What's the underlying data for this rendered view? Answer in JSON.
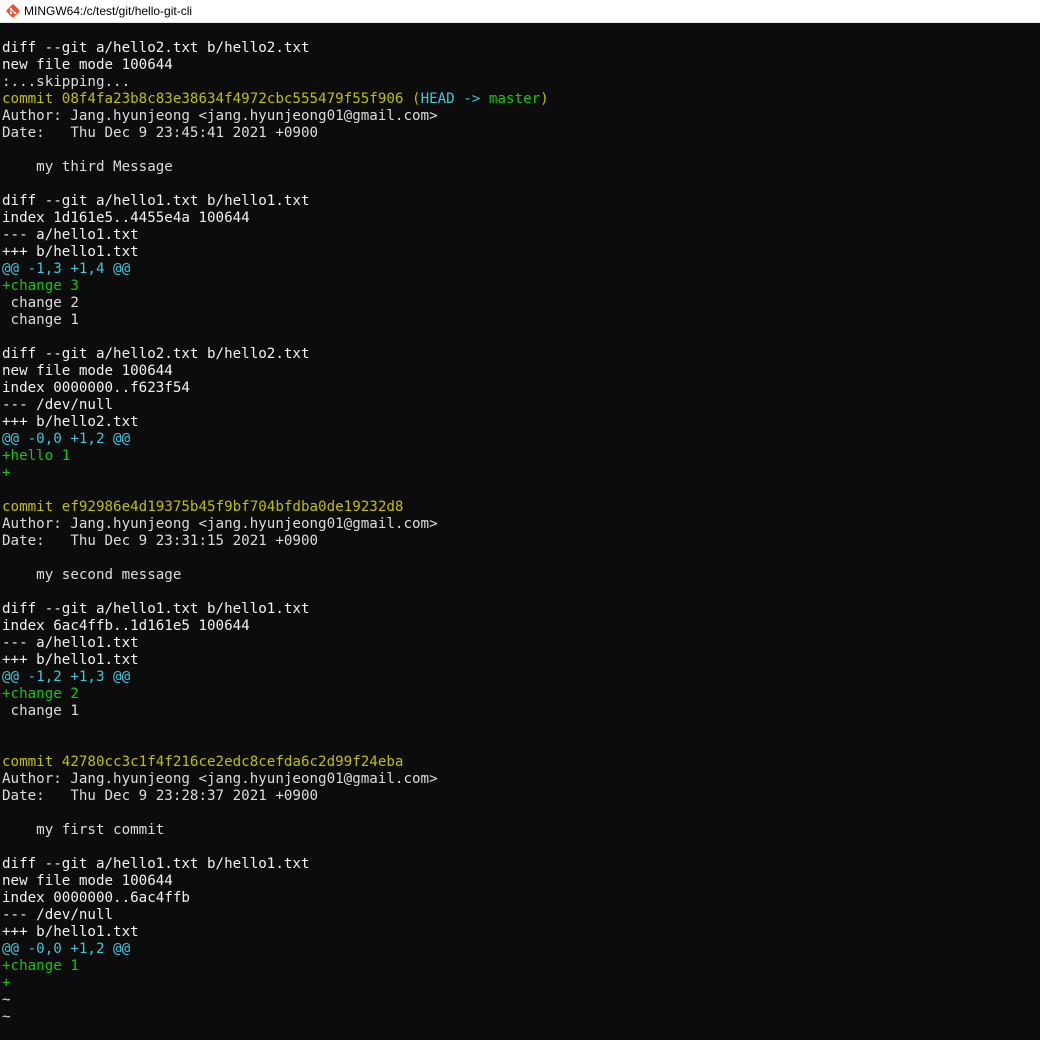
{
  "window": {
    "title": "MINGW64:/c/test/git/hello-git-cli",
    "icon": "git-bash-icon"
  },
  "colors": {
    "background": "#0c0c0c",
    "commit": "#bfbf00",
    "head": "#3cc8dc",
    "branch": "#16c60c",
    "added": "#16c60c",
    "hunk": "#3cc8dc",
    "text": "#dcdcdc"
  },
  "terminal": {
    "lines": [
      {
        "type": "meta",
        "text": "diff --git a/hello2.txt b/hello2.txt"
      },
      {
        "type": "meta",
        "text": "new file mode 100644"
      },
      {
        "type": "plain",
        "text": ":...skipping..."
      },
      {
        "type": "commit-head",
        "hash": "commit 08f4fa23b8c83e38634f4972cbc555479f55f906",
        "open": " (",
        "head": "HEAD ->",
        "branch": " master",
        "close": ")"
      },
      {
        "type": "plain",
        "text": "Author: Jang.hyunjeong <jang.hyunjeong01@gmail.com>"
      },
      {
        "type": "plain",
        "text": "Date:   Thu Dec 9 23:45:41 2021 +0900"
      },
      {
        "type": "plain",
        "text": ""
      },
      {
        "type": "plain",
        "text": "    my third Message"
      },
      {
        "type": "plain",
        "text": ""
      },
      {
        "type": "meta",
        "text": "diff --git a/hello1.txt b/hello1.txt"
      },
      {
        "type": "meta",
        "text": "index 1d161e5..4455e4a 100644"
      },
      {
        "type": "meta",
        "text": "--- a/hello1.txt"
      },
      {
        "type": "meta",
        "text": "+++ b/hello1.txt"
      },
      {
        "type": "hunk",
        "text": "@@ -1,3 +1,4 @@"
      },
      {
        "type": "add",
        "text": "+change 3"
      },
      {
        "type": "plain",
        "text": " change 2"
      },
      {
        "type": "plain",
        "text": " change 1"
      },
      {
        "type": "plain",
        "text": ""
      },
      {
        "type": "meta",
        "text": "diff --git a/hello2.txt b/hello2.txt"
      },
      {
        "type": "meta",
        "text": "new file mode 100644"
      },
      {
        "type": "meta",
        "text": "index 0000000..f623f54"
      },
      {
        "type": "meta",
        "text": "--- /dev/null"
      },
      {
        "type": "meta",
        "text": "+++ b/hello2.txt"
      },
      {
        "type": "hunk",
        "text": "@@ -0,0 +1,2 @@"
      },
      {
        "type": "add",
        "text": "+hello 1"
      },
      {
        "type": "add",
        "text": "+"
      },
      {
        "type": "plain",
        "text": ""
      },
      {
        "type": "commit",
        "text": "commit ef92986e4d19375b45f9bf704bfdba0de19232d8"
      },
      {
        "type": "plain",
        "text": "Author: Jang.hyunjeong <jang.hyunjeong01@gmail.com>"
      },
      {
        "type": "plain",
        "text": "Date:   Thu Dec 9 23:31:15 2021 +0900"
      },
      {
        "type": "plain",
        "text": ""
      },
      {
        "type": "plain",
        "text": "    my second message"
      },
      {
        "type": "plain",
        "text": ""
      },
      {
        "type": "meta",
        "text": "diff --git a/hello1.txt b/hello1.txt"
      },
      {
        "type": "meta",
        "text": "index 6ac4ffb..1d161e5 100644"
      },
      {
        "type": "meta",
        "text": "--- a/hello1.txt"
      },
      {
        "type": "meta",
        "text": "+++ b/hello1.txt"
      },
      {
        "type": "hunk",
        "text": "@@ -1,2 +1,3 @@"
      },
      {
        "type": "add",
        "text": "+change 2"
      },
      {
        "type": "plain",
        "text": " change 1"
      },
      {
        "type": "plain",
        "text": ""
      },
      {
        "type": "plain",
        "text": ""
      },
      {
        "type": "commit",
        "text": "commit 42780cc3c1f4f216ce2edc8cefda6c2d99f24eba"
      },
      {
        "type": "plain",
        "text": "Author: Jang.hyunjeong <jang.hyunjeong01@gmail.com>"
      },
      {
        "type": "plain",
        "text": "Date:   Thu Dec 9 23:28:37 2021 +0900"
      },
      {
        "type": "plain",
        "text": ""
      },
      {
        "type": "plain",
        "text": "    my first commit"
      },
      {
        "type": "plain",
        "text": ""
      },
      {
        "type": "meta",
        "text": "diff --git a/hello1.txt b/hello1.txt"
      },
      {
        "type": "meta",
        "text": "new file mode 100644"
      },
      {
        "type": "meta",
        "text": "index 0000000..6ac4ffb"
      },
      {
        "type": "meta",
        "text": "--- /dev/null"
      },
      {
        "type": "meta",
        "text": "+++ b/hello1.txt"
      },
      {
        "type": "hunk",
        "text": "@@ -0,0 +1,2 @@"
      },
      {
        "type": "add",
        "text": "+change 1"
      },
      {
        "type": "add",
        "text": "+"
      },
      {
        "type": "plain",
        "text": "~"
      },
      {
        "type": "plain",
        "text": "~"
      }
    ]
  }
}
